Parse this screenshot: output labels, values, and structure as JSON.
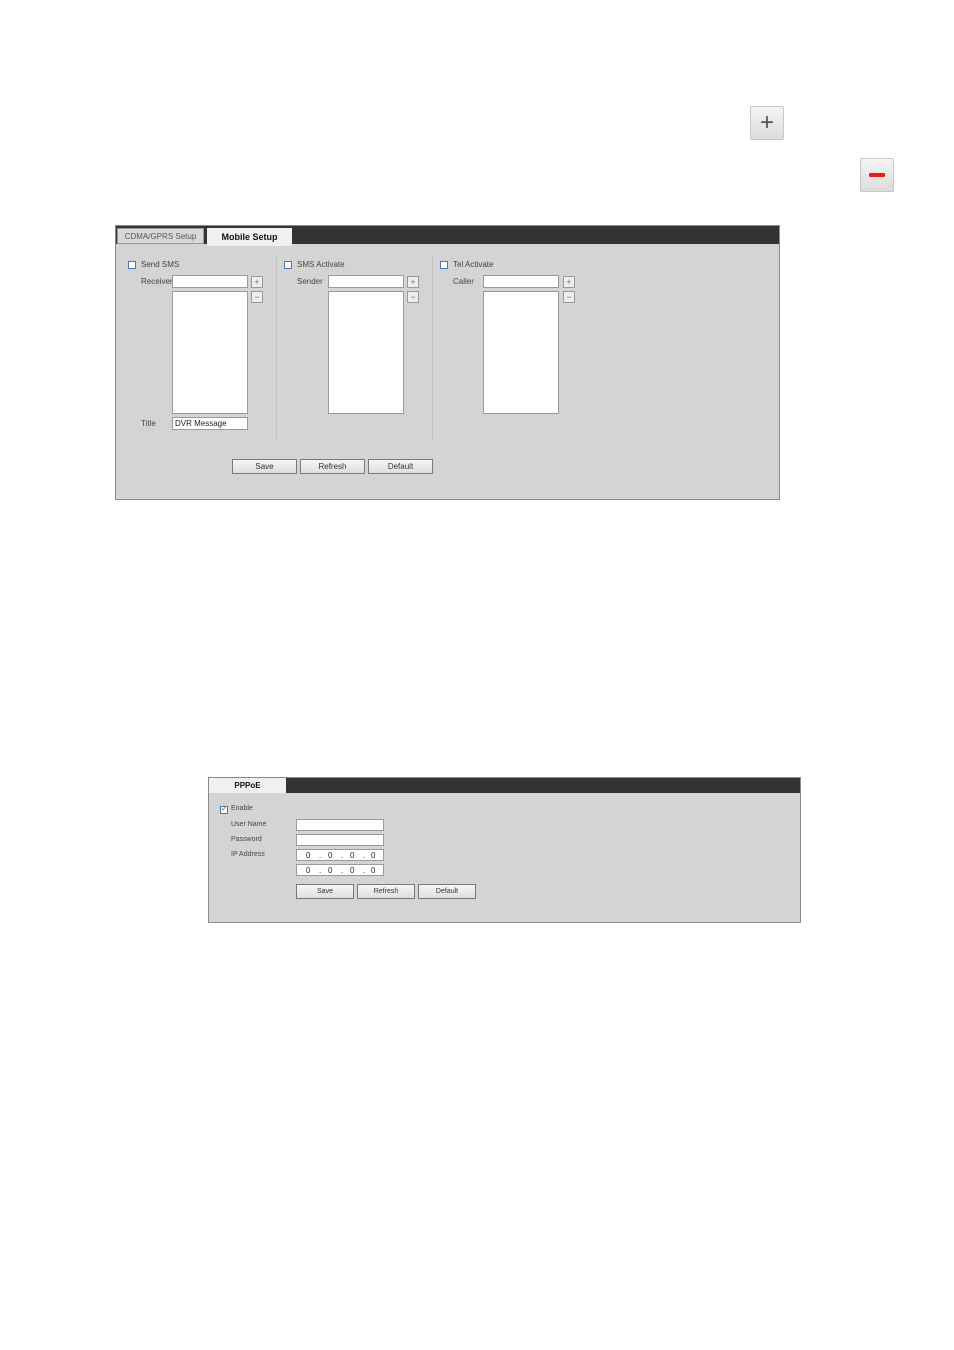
{
  "icons": {
    "plus": "+",
    "minus": "−"
  },
  "mobile": {
    "tabs": [
      {
        "label": "CDMA/GPRS Setup"
      },
      {
        "label": "Mobile Setup"
      }
    ],
    "send_sms": {
      "label": "Send SMS",
      "checked": false,
      "receiver_label": "Receiver",
      "receiver_value": "",
      "title_label": "Title",
      "title_value": "DVR Message"
    },
    "sms_activate": {
      "label": "SMS Activate",
      "checked": false,
      "sender_label": "Sender",
      "sender_value": ""
    },
    "tel_activate": {
      "label": "Tel Activate",
      "checked": false,
      "caller_label": "Caller",
      "caller_value": ""
    },
    "buttons": {
      "save": "Save",
      "refresh": "Refresh",
      "default": "Default"
    }
  },
  "pppoe": {
    "tab": "PPPoE",
    "enable": {
      "label": "Enable",
      "checked": true
    },
    "username_label": "User Name",
    "username_value": "",
    "password_label": "Password",
    "password_value": "",
    "ip_label": "IP Address",
    "ip1": [
      "0",
      "0",
      "0",
      "0"
    ],
    "ip2": [
      "0",
      "0",
      "0",
      "0"
    ],
    "dot": ".",
    "buttons": {
      "save": "Save",
      "refresh": "Refresh",
      "default": "Default"
    }
  }
}
